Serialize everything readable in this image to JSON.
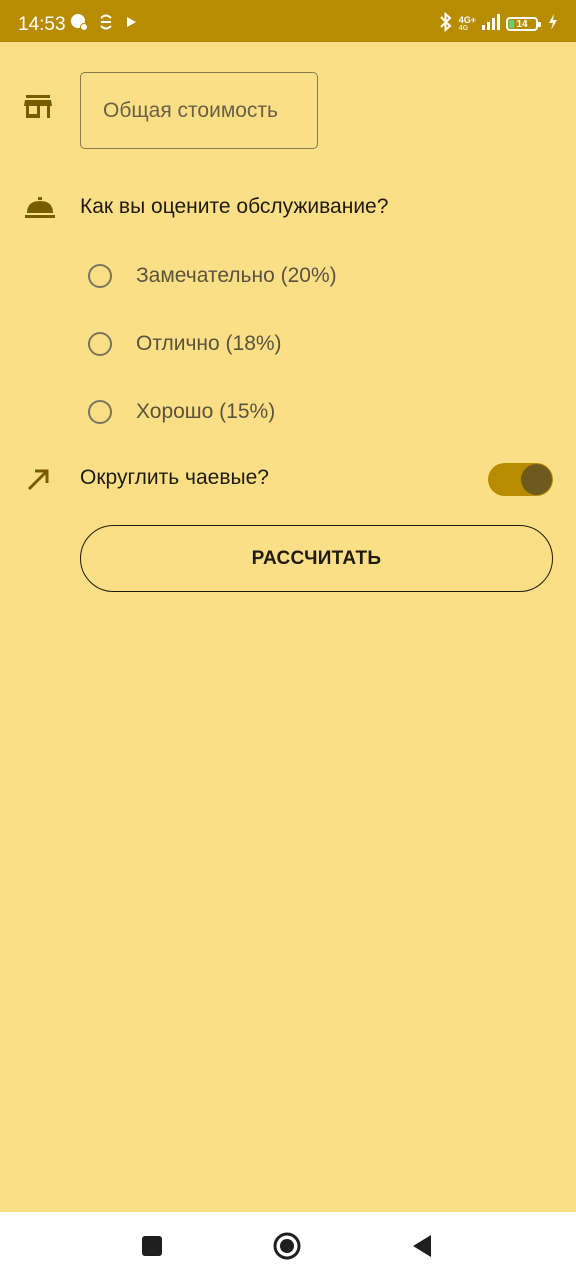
{
  "status_bar": {
    "time": "14:53",
    "network_top": "4G+",
    "network_bottom": "4G",
    "battery_level": "14",
    "left_icons": [
      "app-notification-icon",
      "sync-icon",
      "play-store-icon"
    ],
    "right_icons": [
      "bluetooth-icon",
      "signal-icon",
      "battery-icon",
      "charging-icon"
    ]
  },
  "form": {
    "cost_placeholder": "Общая стоимость",
    "service_question": "Как вы оцените обслуживание?",
    "options": [
      {
        "label": "Замечательно (20%)",
        "selected": false
      },
      {
        "label": "Отлично (18%)",
        "selected": false
      },
      {
        "label": "Хорошо (15%)",
        "selected": false
      }
    ],
    "round_up_label": "Округлить чаевые?",
    "round_up_enabled": true,
    "calculate_label": "РАССЧИТАТЬ"
  },
  "colors": {
    "background": "#fbdf86",
    "status_bar": "#b88c00",
    "accent": "#b88c00",
    "icon": "#7a5c00"
  },
  "nav_bar": {
    "icons": [
      "recents-square-icon",
      "home-circle-icon",
      "back-triangle-icon"
    ]
  }
}
